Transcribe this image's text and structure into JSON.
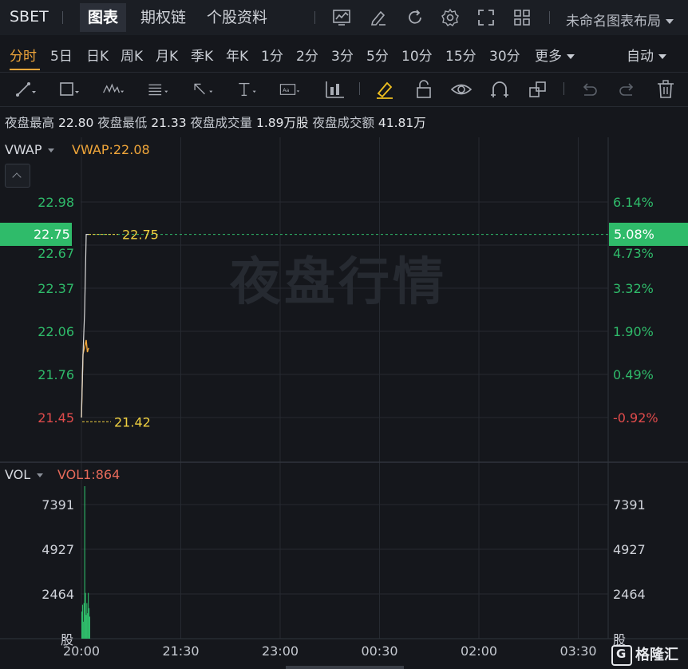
{
  "header": {
    "symbol": "SBET",
    "tabs": [
      {
        "label": "图表",
        "active": true
      },
      {
        "label": "期权链",
        "active": false
      },
      {
        "label": "个股资料",
        "active": false
      }
    ],
    "icons": [
      "indicator-chart-icon",
      "pencil-edit-icon",
      "refresh-icon",
      "gear-icon",
      "fullscreen-icon",
      "grid-layout-icon"
    ],
    "layout_label": "未命名图表布局"
  },
  "intervals": {
    "items": [
      "分时",
      "5日",
      "日K",
      "周K",
      "月K",
      "季K",
      "年K",
      "1分",
      "2分",
      "3分",
      "5分",
      "10分",
      "15分",
      "30分",
      "更多"
    ],
    "active": "分时",
    "mode": "自动"
  },
  "toolbar": {
    "tools": [
      "trendline-tool-icon",
      "rectangle-tool-icon",
      "pattern-tool-icon",
      "text-list-tool-icon",
      "arrow-tool-icon",
      "text-tool-icon",
      "label-tool-icon",
      "bars-tool-icon",
      "highlighter-icon",
      "unlock-icon",
      "eye-icon",
      "magnet-icon",
      "layers-icon",
      "undo-icon",
      "redo-icon",
      "trash-icon"
    ]
  },
  "infobar": {
    "high_label": "夜盘最高",
    "high_value": "22.80",
    "low_label": "夜盘最低",
    "low_value": "21.33",
    "volume_label": "夜盘成交量",
    "volume_value": "1.89万股",
    "amount_label": "夜盘成交额",
    "amount_value": "41.81万"
  },
  "price_panel": {
    "indicator_name": "VWAP",
    "indicator_value": "VWAP:22.08",
    "current_price": "22.75",
    "current_pct": "5.08%",
    "high_marker": "22.75",
    "low_marker": "21.42",
    "y_ticks": [
      "22.98",
      "22.67",
      "22.37",
      "22.06",
      "21.76",
      "21.45"
    ],
    "pct_ticks": [
      "6.14%",
      "4.73%",
      "3.32%",
      "1.90%",
      "0.49%",
      "-0.92%"
    ],
    "watermark": "夜盘行情"
  },
  "volume_panel": {
    "indicator_name": "VOL",
    "indicator_value": "VOL1:864",
    "y_ticks": [
      "7391",
      "4927",
      "2464"
    ],
    "unit": "股"
  },
  "x_axis": {
    "labels": [
      "20:00",
      "21:30",
      "23:00",
      "00:30",
      "02:00",
      "03:30"
    ]
  },
  "colors": {
    "up": "#2fbb6a",
    "down": "#e04b4b",
    "vwap": "#f0a63a",
    "price_line": "#d8d8d8",
    "marker": "#f0d040"
  },
  "brand": "格隆汇",
  "chart_data": {
    "type": "line",
    "title": "",
    "series": [
      {
        "name": "VWAP",
        "x": [
          "20:00",
          "20:01",
          "20:02",
          "20:03",
          "20:04",
          "20:05"
        ],
        "values": [
          21.45,
          21.9,
          21.95,
          22.0,
          22.05,
          22.08
        ]
      },
      {
        "values": [
          21.45,
          21.9,
          22.2,
          22.75,
          22.75,
          22.75
        ]
      }
    ],
    "ylim": [
      21.3,
      23.1
    ],
    "volume": {
      "ylim": [
        0,
        9000
      ],
      "values": [
        1600,
        2000,
        1000,
        2100,
        9000,
        2700,
        1400,
        2100,
        1500,
        2700,
        1800,
        1300
      ]
    },
    "markers": {
      "high": 22.75,
      "low": 21.42
    },
    "grid": true
  }
}
